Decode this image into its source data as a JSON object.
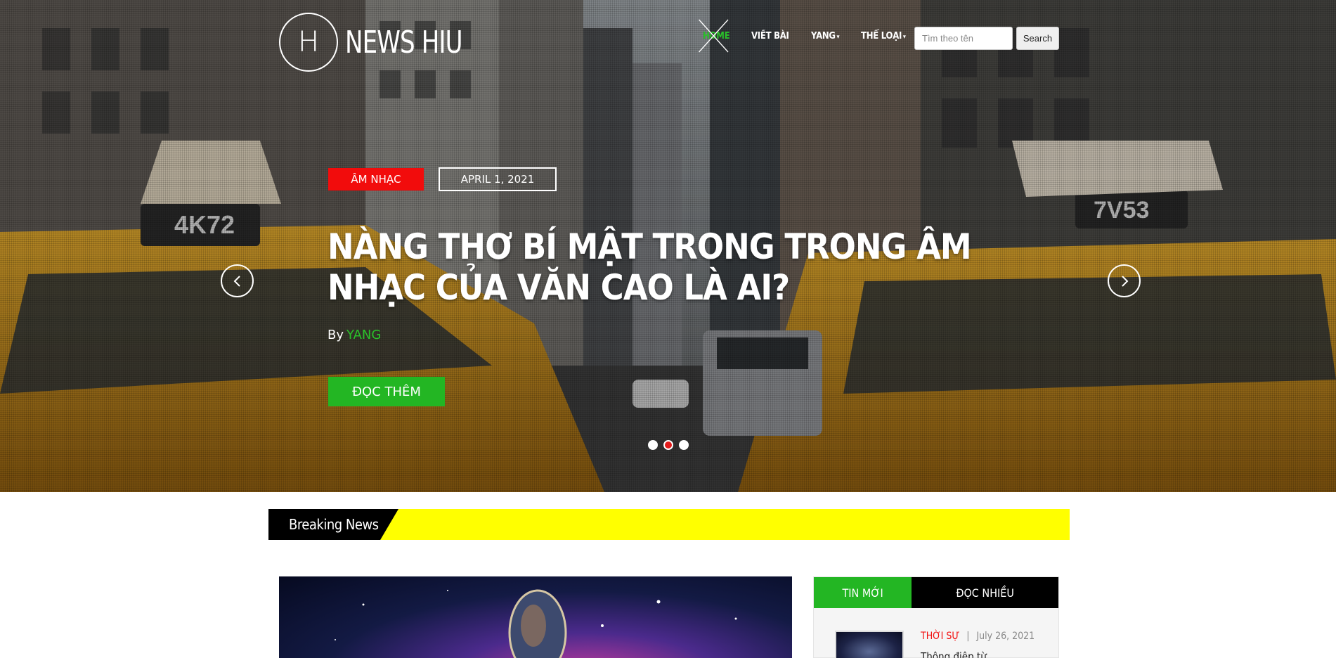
{
  "header": {
    "logo_letter": "H",
    "logo_text": "NEWS HIU",
    "nav": [
      {
        "label": "HOME",
        "active": true
      },
      {
        "label": "VIẾT BÀI"
      },
      {
        "label": "YANG",
        "dropdown": true
      },
      {
        "label": "THỂ LOẠI",
        "dropdown": true
      }
    ],
    "search_placeholder": "Tìm theo tên",
    "search_button": "Search"
  },
  "slide": {
    "category": "ÂM NHẠC",
    "date": "APRIL 1, 2021",
    "title": "NÀNG THƠ BÍ MẬT TRONG TRONG ÂM NHẠC CỦA VĂN CAO LÀ AI?",
    "by": "By",
    "author": "YANG",
    "read_more": "ĐỌC THÊM",
    "active_dot": 1,
    "dots": 3
  },
  "breaking": {
    "label": "Breaking News"
  },
  "sidebar": {
    "tab_new": "TIN MỚI",
    "tab_popular": "ĐỌC NHIỀU",
    "item": {
      "category": "THỜI SỰ",
      "separator": "|",
      "date": "July 26, 2021",
      "title": "Thông điệp từ..."
    }
  },
  "colors": {
    "accent_green": "#23b623",
    "accent_red": "#f20c0c",
    "breaking_yellow": "#ffff00"
  }
}
